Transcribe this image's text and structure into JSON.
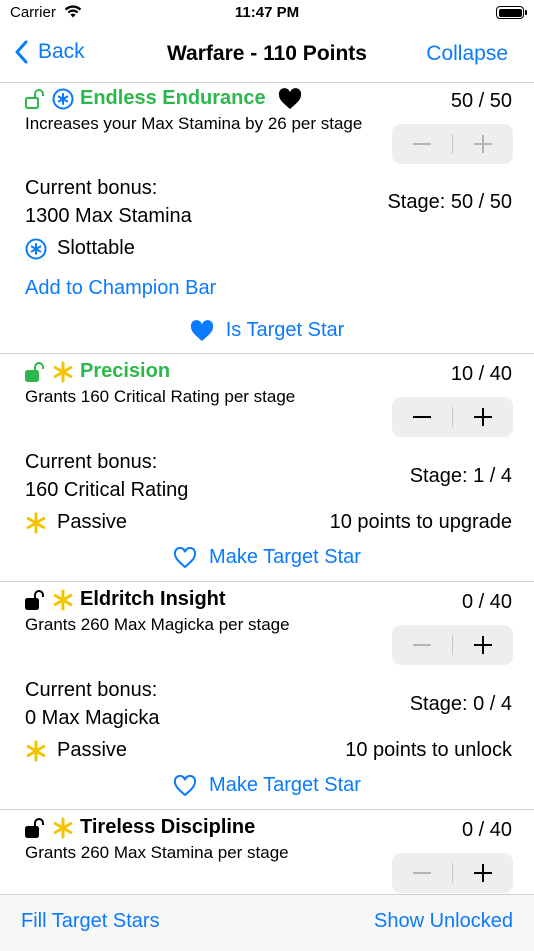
{
  "status": {
    "carrier": "Carrier",
    "time": "11:47 PM"
  },
  "nav": {
    "back": "Back",
    "title": "Warfare - 110 Points",
    "collapse": "Collapse"
  },
  "colors": {
    "accent": "#0a7aff",
    "slottable_green": "#2db84b",
    "passive_yellow": "#f5c400"
  },
  "stars": [
    {
      "name": "Endless Endurance",
      "points": "50 / 50",
      "description": "Increases your Max Stamina by 26 per stage",
      "bonus_label": "Current bonus:",
      "bonus_value": "1300 Max Stamina",
      "stage": "Stage: 50 / 50",
      "type": "Slottable",
      "type_icon": "slottable-asterisk-circle-icon",
      "lock_icon": "unlocked-lock-icon",
      "add_to_bar": "Add to Champion Bar",
      "target_label": "Is Target Star",
      "target_icon": "heart-filled-icon"
    },
    {
      "name": "Precision",
      "points": "10 / 40",
      "description": "Grants 160 Critical Rating per stage",
      "bonus_label": "Current bonus:",
      "bonus_value": "160 Critical Rating",
      "stage": "Stage: 1 / 4",
      "type": "Passive",
      "type_icon": "passive-asterisk-icon",
      "lock_icon": "unlocked-lock-icon",
      "upgrade": "10 points to upgrade",
      "target_label": "Make Target Star",
      "target_icon": "heart-outline-icon"
    },
    {
      "name": "Eldritch Insight",
      "points": "0 / 40",
      "description": "Grants 260 Max Magicka per stage",
      "bonus_label": "Current bonus:",
      "bonus_value": "0 Max Magicka",
      "stage": "Stage: 0 / 4",
      "type": "Passive",
      "type_icon": "passive-asterisk-icon",
      "lock_icon": "unlocked-lock-icon",
      "upgrade": "10 points to unlock",
      "target_label": "Make Target Star",
      "target_icon": "heart-outline-icon"
    },
    {
      "name": "Tireless Discipline",
      "points": "0 / 40",
      "description": "Grants 260 Max Stamina per stage",
      "type_icon": "passive-asterisk-icon",
      "lock_icon": "unlocked-lock-icon"
    }
  ],
  "bottom": {
    "fill": "Fill Target Stars",
    "show": "Show Unlocked"
  }
}
